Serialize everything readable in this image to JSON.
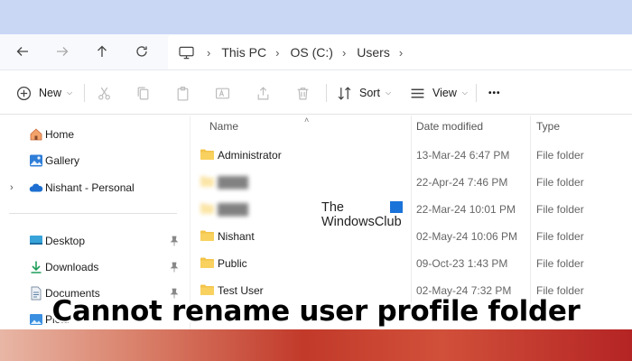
{
  "address": {
    "crumbs": [
      "This PC",
      "OS (C:)",
      "Users"
    ]
  },
  "toolbar": {
    "new_label": "New",
    "sort_label": "Sort",
    "view_label": "View",
    "more_label": "•••"
  },
  "sidebar": {
    "items": [
      {
        "label": "Home",
        "icon": "home-icon"
      },
      {
        "label": "Gallery",
        "icon": "gallery-icon"
      },
      {
        "label": "Nishant - Personal",
        "icon": "onedrive-icon"
      },
      {
        "label": "Desktop",
        "icon": "desktop-icon"
      },
      {
        "label": "Downloads",
        "icon": "download-icon"
      },
      {
        "label": "Documents",
        "icon": "documents-icon"
      },
      {
        "label": "Pictu",
        "icon": "pictures-icon"
      }
    ]
  },
  "columns": {
    "name": "Name",
    "date": "Date modified",
    "type": "Type"
  },
  "files": [
    {
      "name": "Administrator",
      "date": "13-Mar-24 6:47 PM",
      "type": "File folder"
    },
    {
      "name": "",
      "date": "22-Apr-24 7:46 PM",
      "type": "File folder"
    },
    {
      "name": "",
      "date": "22-Mar-24 10:01 PM",
      "type": "File folder"
    },
    {
      "name": "Nishant",
      "date": "02-May-24 10:06 PM",
      "type": "File folder"
    },
    {
      "name": "Public",
      "date": "09-Oct-23 1:43 PM",
      "type": "File folder"
    },
    {
      "name": "Test User",
      "date": "02-May-24 7:32 PM",
      "type": "File folder"
    }
  ],
  "watermark": {
    "line1": "The",
    "line2": "WindowsClub"
  },
  "headline": "Cannot rename user profile folder",
  "colors": {
    "titlebar": "#c9d7f5",
    "folder": "#f3c44a",
    "accent": "#1a73d9"
  }
}
